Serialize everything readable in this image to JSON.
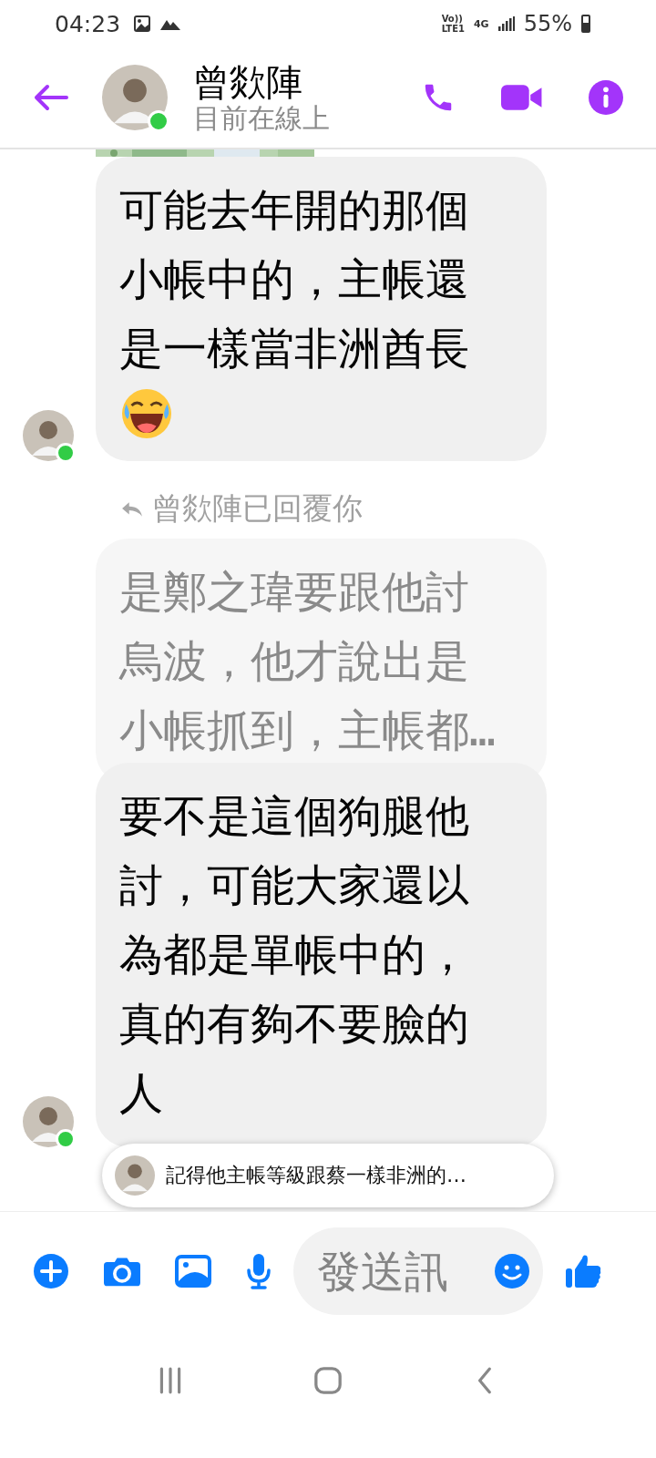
{
  "status_bar": {
    "time": "04:23",
    "volte": "Vo))",
    "lte": "LTE1",
    "network": "4G",
    "battery": "55%"
  },
  "header": {
    "name": "曾欻陣",
    "status": "目前在線上",
    "online": true
  },
  "messages": [
    {
      "kind": "picture"
    },
    {
      "kind": "bubble",
      "text": "可能去年開的那個小帳中的，主帳還是一樣當非洲酋長",
      "laugh_emoji": true,
      "avatar": true,
      "online": true,
      "quoted": false
    },
    {
      "kind": "reply_label",
      "text": "曾欻陣已回覆你"
    },
    {
      "kind": "bubble",
      "text": "是鄭之瑋要跟他討烏波，他才說出是小帳抓到，主帳都…",
      "avatar": false,
      "quoted": true
    },
    {
      "kind": "bubble",
      "text": "要不是這個狗腿他討，可能大家還以為都是單帳中的，真的有夠不要臉的人",
      "avatar": true,
      "online": true,
      "quoted": false
    }
  ],
  "new_message_popup": {
    "text": "記得他主帳等級跟蔡一樣非洲的…"
  },
  "composer": {
    "placeholder": "發送訊"
  }
}
